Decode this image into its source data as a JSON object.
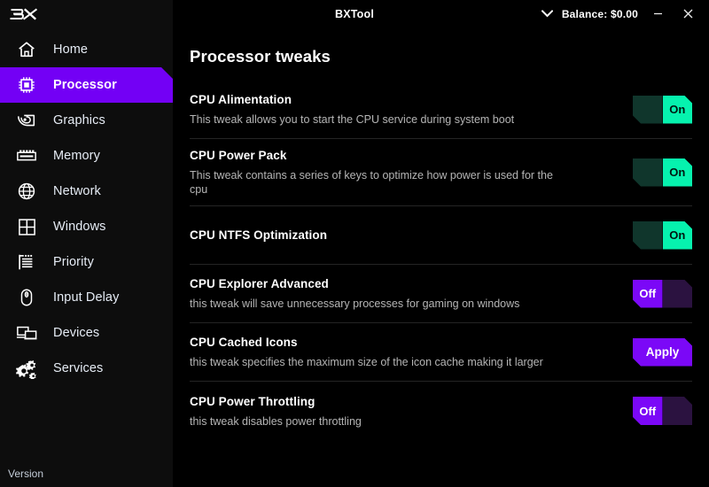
{
  "window": {
    "logo_text": "BX",
    "title": "BXTool",
    "balance": "Balance: $0.00",
    "chevron_icon": "chevron-down-icon",
    "minimize_label": "–",
    "close_label": "✕"
  },
  "sidebar": {
    "version_label": "Version",
    "items": [
      {
        "label": "Home",
        "icon": "home-icon",
        "active": false
      },
      {
        "label": "Processor",
        "icon": "cpu-icon",
        "active": true
      },
      {
        "label": "Graphics",
        "icon": "gpu-icon",
        "active": false
      },
      {
        "label": "Memory",
        "icon": "ram-icon",
        "active": false
      },
      {
        "label": "Network",
        "icon": "globe-icon",
        "active": false
      },
      {
        "label": "Windows",
        "icon": "windows-icon",
        "active": false
      },
      {
        "label": "Priority",
        "icon": "priority-icon",
        "active": false
      },
      {
        "label": "Input Delay",
        "icon": "mouse-icon",
        "active": false
      },
      {
        "label": "Devices",
        "icon": "devices-icon",
        "active": false
      },
      {
        "label": "Services",
        "icon": "gears-icon",
        "active": false
      }
    ]
  },
  "main": {
    "page_title": "Processor tweaks",
    "rows": [
      {
        "title": "CPU Alimentation",
        "desc": "This tweak allows you to start the CPU service during system boot",
        "control": "toggle",
        "state": "on",
        "state_label": "On"
      },
      {
        "title": "CPU Power Pack",
        "desc": "This tweak contains a series of keys to optimize how power is used for the cpu",
        "control": "toggle",
        "state": "on",
        "state_label": "On"
      },
      {
        "title": "CPU NTFS Optimization",
        "desc": "",
        "control": "toggle",
        "state": "on",
        "state_label": "On"
      },
      {
        "title": "CPU Explorer Advanced",
        "desc": "this tweak will save unnecessary processes for gaming on windows",
        "control": "toggle",
        "state": "off",
        "state_label": "Off"
      },
      {
        "title": "CPU Cached Icons",
        "desc": "this tweak specifies the maximum size of the icon cache making it larger",
        "control": "button",
        "state": "",
        "state_label": "Apply"
      },
      {
        "title": "CPU Power Throttling",
        "desc": "this tweak disables power throttling",
        "control": "toggle",
        "state": "off",
        "state_label": "Off"
      }
    ]
  },
  "colors": {
    "accent_purple": "#7b08f7",
    "accent_purple_dark": "#2b1240",
    "accent_cyan": "#06f2ae",
    "accent_cyan_dark": "#10362c",
    "sidebar_bg": "#0d0d0d",
    "main_bg": "#000000"
  }
}
